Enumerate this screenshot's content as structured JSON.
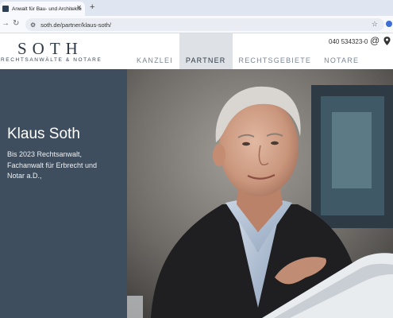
{
  "browser": {
    "tab_title": "Anwalt für Bau- und Architektenrecht",
    "url": "soth.de/partner/klaus-soth/"
  },
  "site": {
    "logo": "SOTH",
    "logo_subtitle": "RECHTSANWÄLTE & NOTARE",
    "phone": "040 534323-0",
    "nav": [
      {
        "label": "KANZLEI",
        "active": false
      },
      {
        "label": "PARTNER",
        "active": true
      },
      {
        "label": "RECHTSGEBIETE",
        "active": false
      },
      {
        "label": "NOTARE",
        "active": false
      }
    ]
  },
  "hero": {
    "name": "Klaus Soth",
    "description_lines": [
      "Bis 2023 Rechtsanwalt,",
      "Fachanwalt für Erbrecht und",
      "Notar a.D.,"
    ]
  },
  "colors": {
    "panel": "#3e4e5f",
    "nav_active_bg": "#dee2e6",
    "nav_text": "#7a8794"
  },
  "icons": {
    "email": "at-icon",
    "location": "map-pin-icon"
  }
}
